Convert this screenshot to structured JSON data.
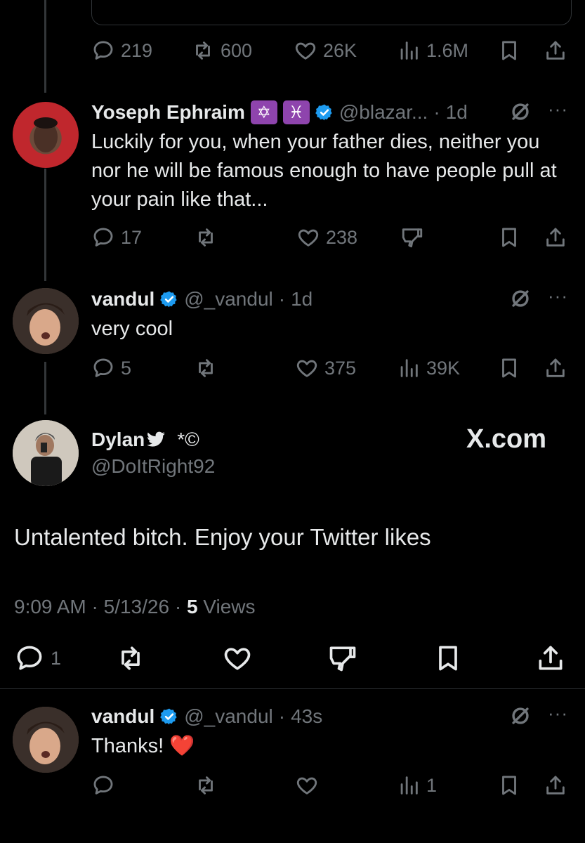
{
  "top_post": {
    "stats": {
      "replies": "219",
      "reposts": "600",
      "likes": "26K",
      "views": "1.6M"
    }
  },
  "reply1": {
    "name": "Yoseph Ephraim",
    "badges": [
      "✡",
      "♓"
    ],
    "handle": "@blazar...",
    "dot": "·",
    "time": "1d",
    "text": "Luckily for you, when your father dies, neither you nor he will be famous enough to have people pull at your pain like that...",
    "stats": {
      "replies": "17",
      "likes": "238"
    }
  },
  "reply2": {
    "name": "vandul",
    "handle": "@_vandul",
    "dot": "·",
    "time": "1d",
    "text": "very cool",
    "stats": {
      "replies": "5",
      "likes": "375",
      "views": "39K"
    }
  },
  "focal": {
    "name": "Dylan",
    "name_suffix": "*©",
    "handle": "@DoItRight92",
    "brand": "X.com",
    "text": "Untalented bitch. Enjoy your Twitter likes",
    "time": "9:09 AM",
    "date": "5/13/26",
    "views_count": "5",
    "views_label": "Views",
    "dot": "·",
    "stats": {
      "replies": "1"
    }
  },
  "reply3": {
    "name": "vandul",
    "handle": "@_vandul",
    "dot": "·",
    "time": "43s",
    "text": "Thanks!",
    "emoji": "❤️",
    "stats": {
      "views": "1"
    }
  },
  "colors": {
    "background": "#000000",
    "text": "#e7e9ea",
    "muted": "#71767b",
    "verified": "#1d9bf0",
    "divider": "#2f3336"
  }
}
